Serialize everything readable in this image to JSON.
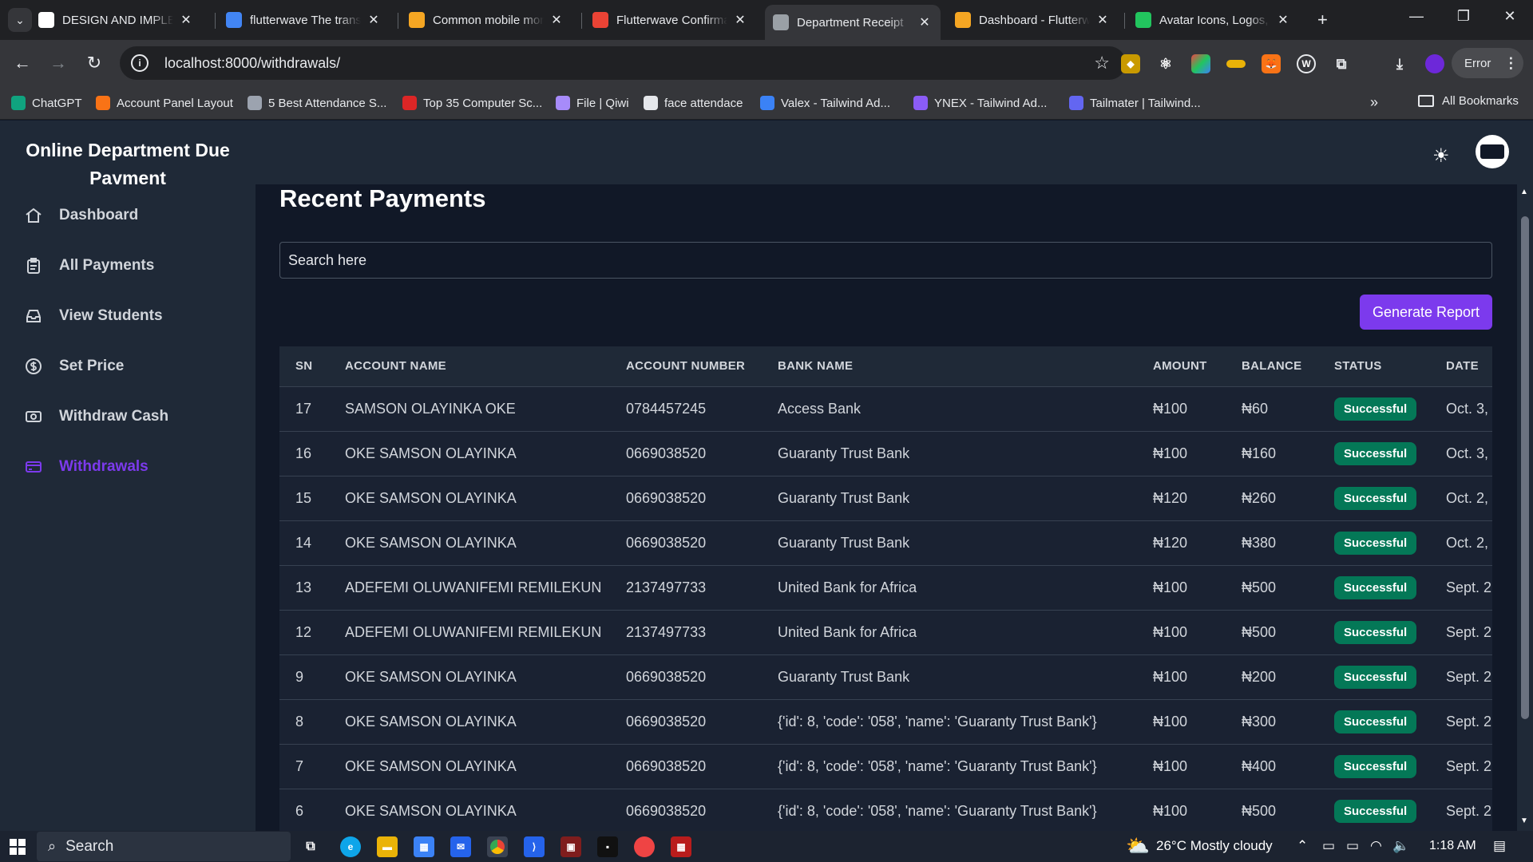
{
  "browser": {
    "tabs": [
      {
        "title": "DESIGN AND IMPLEMENTATION",
        "icon": "document-icon",
        "color": "#ffffff"
      },
      {
        "title": "flutterwave The transfer",
        "icon": "google-icon",
        "color": "#4285f4"
      },
      {
        "title": "Common mobile money",
        "icon": "flutterwave-icon",
        "color": "#f5a623"
      },
      {
        "title": "Flutterwave Confirmation",
        "icon": "gmail-icon",
        "color": "#ea4335"
      },
      {
        "title": "Department Receipt",
        "icon": "globe-icon",
        "color": "#9aa0a6"
      },
      {
        "title": "Dashboard - Flutterwave",
        "icon": "flutterwave-icon",
        "color": "#f5a623"
      },
      {
        "title": "Avatar Icons, Logos, Symbols",
        "icon": "avatar-icon",
        "color": "#22c55e"
      }
    ],
    "url": "localhost:8000/withdrawals/",
    "error_chip": "Error",
    "bookmarks": [
      {
        "label": "ChatGPT",
        "color": "#10a37f"
      },
      {
        "label": "Account Panel Layout",
        "color": "#f97316"
      },
      {
        "label": "5 Best Attendance S...",
        "color": "#9ca3af"
      },
      {
        "label": "Top 35 Computer Sc...",
        "color": "#dc2626"
      },
      {
        "label": "File | Qiwi",
        "color": "#a78bfa"
      },
      {
        "label": "face attendace",
        "color": "#e5e7eb"
      },
      {
        "label": "Valex - Tailwind Ad...",
        "color": "#3b82f6"
      },
      {
        "label": "YNEX - Tailwind Ad...",
        "color": "#8b5cf6"
      },
      {
        "label": "Tailmater | Tailwind...",
        "color": "#6366f1"
      }
    ],
    "all_bookmarks": "All Bookmarks"
  },
  "app": {
    "brand": "Online Department Due Payment",
    "nav": [
      {
        "label": "Dashboard",
        "icon": "home-icon",
        "active": false
      },
      {
        "label": "All Payments",
        "icon": "clipboard-icon",
        "active": false
      },
      {
        "label": "View Students",
        "icon": "inbox-icon",
        "active": false
      },
      {
        "label": "Set Price",
        "icon": "dollar-icon",
        "active": false
      },
      {
        "label": "Withdraw Cash",
        "icon": "cash-icon",
        "active": false
      },
      {
        "label": "Withdrawals",
        "icon": "credit-card-icon",
        "active": true
      }
    ],
    "accent": "#7c3aed",
    "page_title": "Recent Payments",
    "search_placeholder": "Search here",
    "generate_button": "Generate Report",
    "columns": [
      "SN",
      "ACCOUNT NAME",
      "ACCOUNT NUMBER",
      "BANK NAME",
      "AMOUNT",
      "BALANCE",
      "STATUS",
      "DATE"
    ],
    "rows": [
      {
        "sn": "17",
        "name": "SAMSON OLAYINKA OKE",
        "number": "0784457245",
        "bank": "Access Bank",
        "amount": "₦100",
        "balance": "₦60",
        "status": "Successful",
        "date": "Oct. 3,"
      },
      {
        "sn": "16",
        "name": "OKE SAMSON OLAYINKA",
        "number": "0669038520",
        "bank": "Guaranty Trust Bank",
        "amount": "₦100",
        "balance": "₦160",
        "status": "Successful",
        "date": "Oct. 3,"
      },
      {
        "sn": "15",
        "name": "OKE SAMSON OLAYINKA",
        "number": "0669038520",
        "bank": "Guaranty Trust Bank",
        "amount": "₦120",
        "balance": "₦260",
        "status": "Successful",
        "date": "Oct. 2,"
      },
      {
        "sn": "14",
        "name": "OKE SAMSON OLAYINKA",
        "number": "0669038520",
        "bank": "Guaranty Trust Bank",
        "amount": "₦120",
        "balance": "₦380",
        "status": "Successful",
        "date": "Oct. 2,"
      },
      {
        "sn": "13",
        "name": "ADEFEMI OLUWANIFEMI REMILEKUN",
        "number": "2137497733",
        "bank": "United Bank for Africa",
        "amount": "₦100",
        "balance": "₦500",
        "status": "Successful",
        "date": "Sept. 2"
      },
      {
        "sn": "12",
        "name": "ADEFEMI OLUWANIFEMI REMILEKUN",
        "number": "2137497733",
        "bank": "United Bank for Africa",
        "amount": "₦100",
        "balance": "₦500",
        "status": "Successful",
        "date": "Sept. 2"
      },
      {
        "sn": "9",
        "name": "OKE SAMSON OLAYINKA",
        "number": "0669038520",
        "bank": "Guaranty Trust Bank",
        "amount": "₦100",
        "balance": "₦200",
        "status": "Successful",
        "date": "Sept. 2"
      },
      {
        "sn": "8",
        "name": "OKE SAMSON OLAYINKA",
        "number": "0669038520",
        "bank": "{'id': 8, 'code': '058', 'name': 'Guaranty Trust Bank'}",
        "amount": "₦100",
        "balance": "₦300",
        "status": "Successful",
        "date": "Sept. 2"
      },
      {
        "sn": "7",
        "name": "OKE SAMSON OLAYINKA",
        "number": "0669038520",
        "bank": "{'id': 8, 'code': '058', 'name': 'Guaranty Trust Bank'}",
        "amount": "₦100",
        "balance": "₦400",
        "status": "Successful",
        "date": "Sept. 2"
      },
      {
        "sn": "6",
        "name": "OKE SAMSON OLAYINKA",
        "number": "0669038520",
        "bank": "{'id': 8, 'code': '058', 'name': 'Guaranty Trust Bank'}",
        "amount": "₦100",
        "balance": "₦500",
        "status": "Successful",
        "date": "Sept. 2"
      }
    ]
  },
  "taskbar": {
    "search": "Search",
    "weather": "26°C  Mostly cloudy",
    "time": "1:18 AM"
  }
}
